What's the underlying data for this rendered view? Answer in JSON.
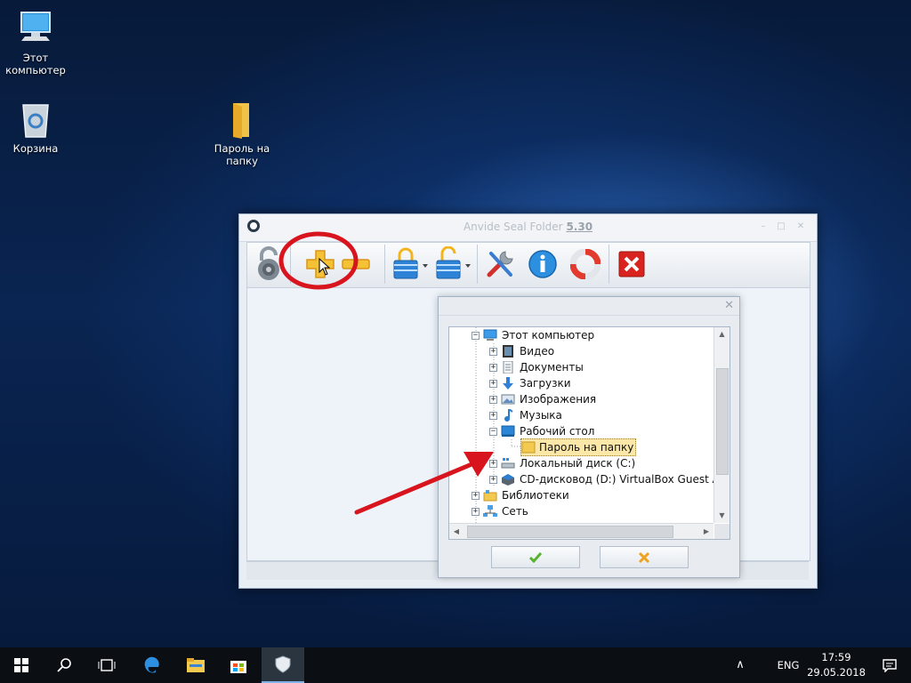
{
  "desktop": {
    "icons": [
      {
        "label": "Этот компьютер"
      },
      {
        "label": "Корзина"
      },
      {
        "label": "Пароль на папку"
      }
    ]
  },
  "app": {
    "title": "Anvide Seal Folder",
    "version": "5.30",
    "toolbar": [
      {
        "name": "lock-icon"
      },
      {
        "name": "add-folder-icon"
      },
      {
        "name": "remove-folder-icon"
      },
      {
        "name": "close-access-icon"
      },
      {
        "name": "open-access-icon"
      },
      {
        "name": "settings-icon"
      },
      {
        "name": "info-icon"
      },
      {
        "name": "help-icon"
      },
      {
        "name": "exit-icon"
      }
    ]
  },
  "dialog": {
    "tree": [
      {
        "label": "Этот компьютер",
        "expanded": true,
        "icon": "computer-icon"
      },
      {
        "label": "Видео",
        "icon": "video-icon"
      },
      {
        "label": "Документы",
        "icon": "documents-icon"
      },
      {
        "label": "Загрузки",
        "icon": "downloads-icon"
      },
      {
        "label": "Изображения",
        "icon": "images-icon"
      },
      {
        "label": "Музыка",
        "icon": "music-icon"
      },
      {
        "label": "Рабочий стол",
        "expanded": true,
        "icon": "desktop-icon"
      },
      {
        "label": "Пароль на папку",
        "selected": true,
        "icon": "folder-icon"
      },
      {
        "label": "Локальный диск (C:)",
        "icon": "disk-icon"
      },
      {
        "label": "CD-дисковод (D:) VirtualBox Guest Ad",
        "icon": "cd-icon"
      },
      {
        "label": "Библиотеки",
        "icon": "libraries-icon"
      },
      {
        "label": "Сеть",
        "icon": "network-icon"
      }
    ]
  },
  "taskbar": {
    "lang": "ENG",
    "time": "17:59",
    "date": "29.05.2018"
  },
  "colors": {
    "accent_red": "#d8141e",
    "tree_selected": "#fbe7a8",
    "folder_yellow": "#f3c94f"
  }
}
